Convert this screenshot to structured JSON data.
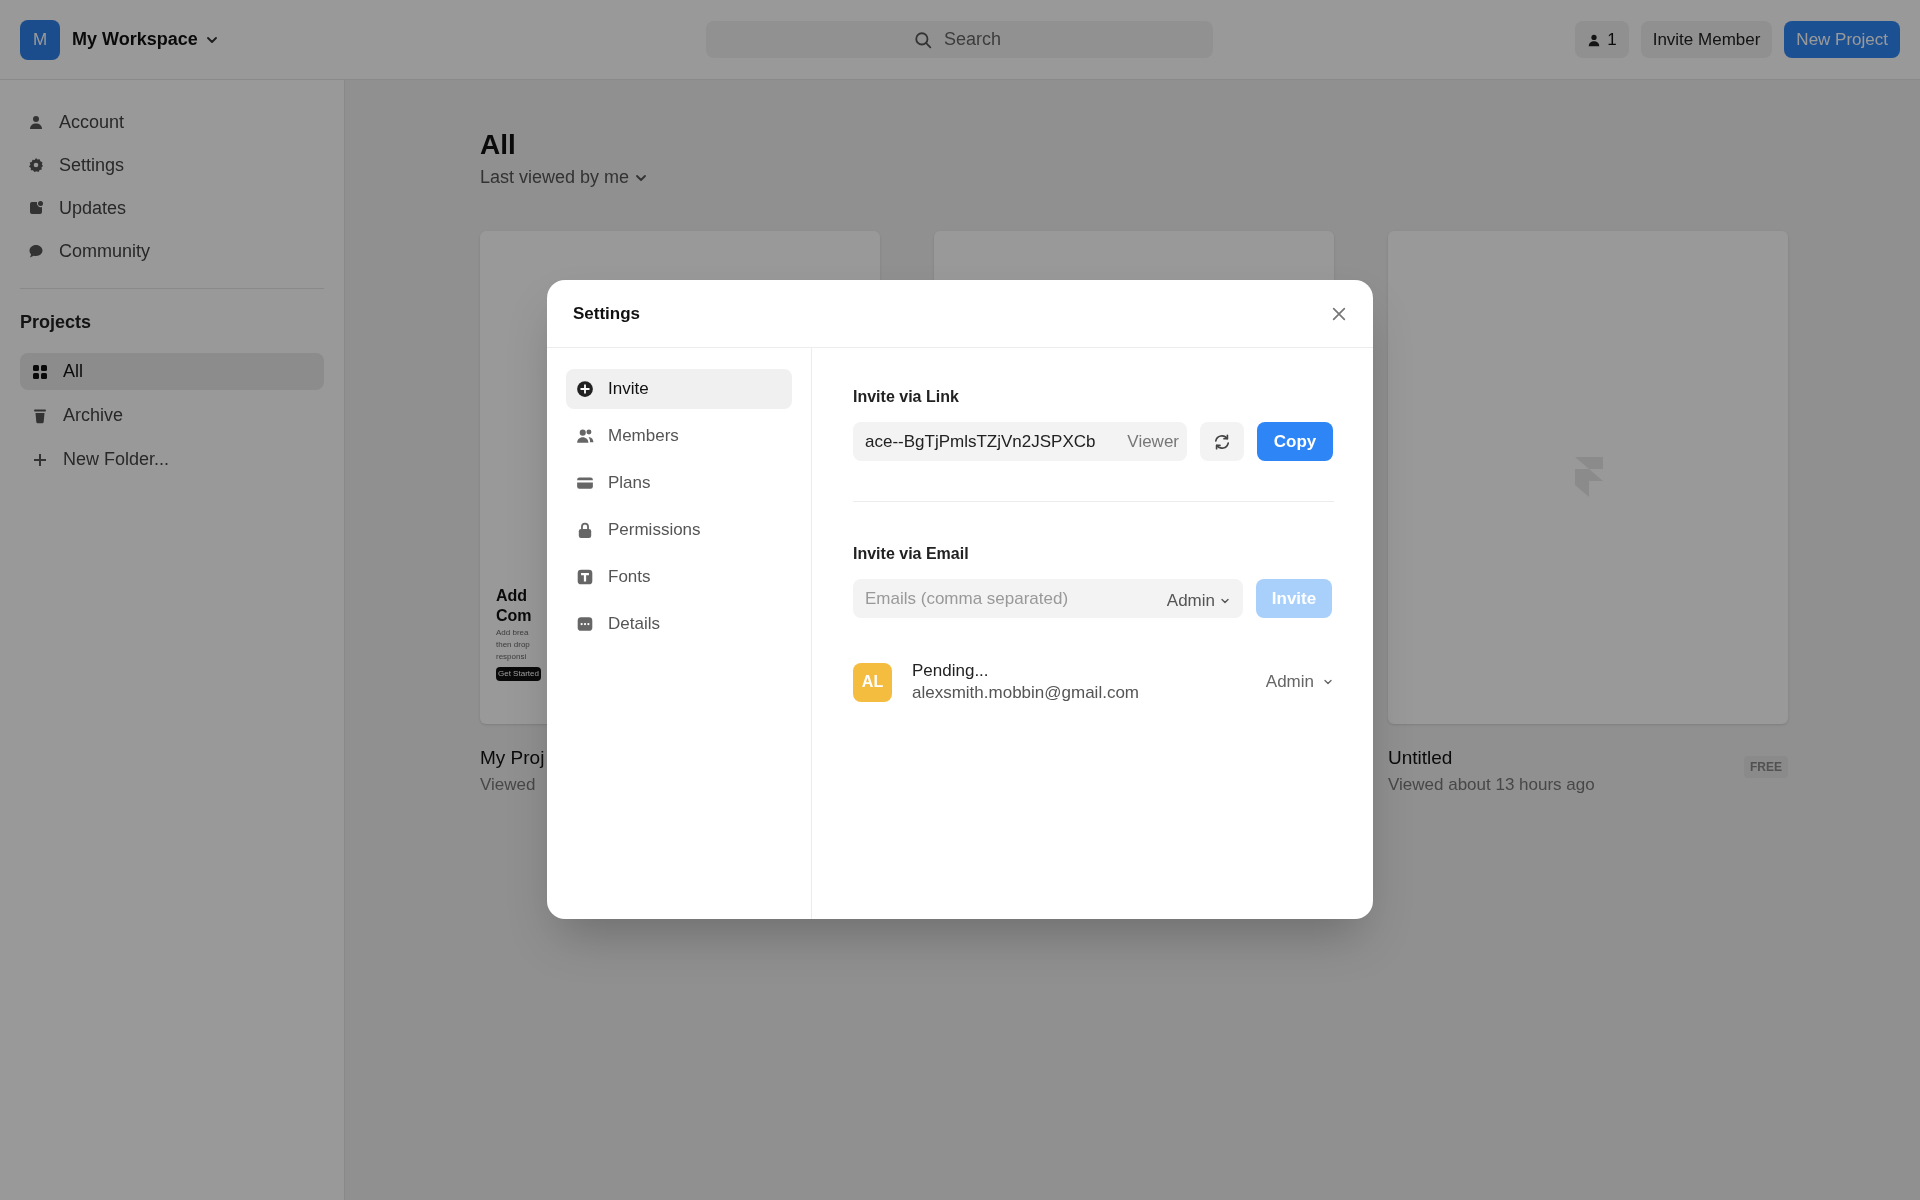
{
  "topbar": {
    "workspace": {
      "initial": "M",
      "name": "My Workspace"
    },
    "search": {
      "placeholder": "Search"
    },
    "member_count": "1",
    "buttons": [
      {
        "label": "Invite Member",
        "kind": "secondary"
      },
      {
        "label": "New Project",
        "kind": "primary"
      }
    ]
  },
  "sidebar": {
    "items": [
      {
        "label": "Account"
      },
      {
        "label": "Settings"
      },
      {
        "label": "Updates"
      },
      {
        "label": "Community"
      }
    ],
    "section_title": "Projects",
    "projects": [
      {
        "label": "All",
        "selected": true
      },
      {
        "label": "Archive",
        "selected": false
      },
      {
        "label": "New Folder...",
        "selected": false
      }
    ]
  },
  "main": {
    "title": "All",
    "sort": "Last viewed by me",
    "cards": [
      {
        "kind": "landing",
        "title": "My Proj",
        "subtitle": "Viewed",
        "thumb_texts": {
          "heading_1": "Add",
          "heading_2": "Com",
          "body": [
            "Add brea",
            "then drop",
            "responsi"
          ],
          "button": "Get Started"
        }
      },
      {
        "kind": "blank"
      },
      {
        "kind": "logo",
        "title": "Untitled",
        "subtitle": "Viewed about 13 hours ago",
        "badge": "FREE"
      }
    ]
  },
  "dialog": {
    "title": "Settings",
    "nav": [
      {
        "label": "Invite",
        "selected": true
      },
      {
        "label": "Members",
        "selected": false
      },
      {
        "label": "Plans",
        "selected": false
      },
      {
        "label": "Permissions",
        "selected": false
      },
      {
        "label": "Fonts",
        "selected": false
      },
      {
        "label": "Details",
        "selected": false
      }
    ],
    "link_section": {
      "title": "Invite via Link",
      "link": "ace--BgTjPmlsTZjVn2JSPXCb",
      "role": "Viewer",
      "copy_button": "Copy"
    },
    "email_section": {
      "title": "Invite via Email",
      "placeholder": "Emails (comma separated)",
      "role": "Admin",
      "invite_button": {
        "label": "Invite",
        "disabled": true
      }
    },
    "members": [
      {
        "initials": "AL",
        "color": "#f5bd3f",
        "status": "Pending...",
        "email": "alexsmith.mobbin@gmail.com",
        "role": "Admin"
      }
    ]
  }
}
